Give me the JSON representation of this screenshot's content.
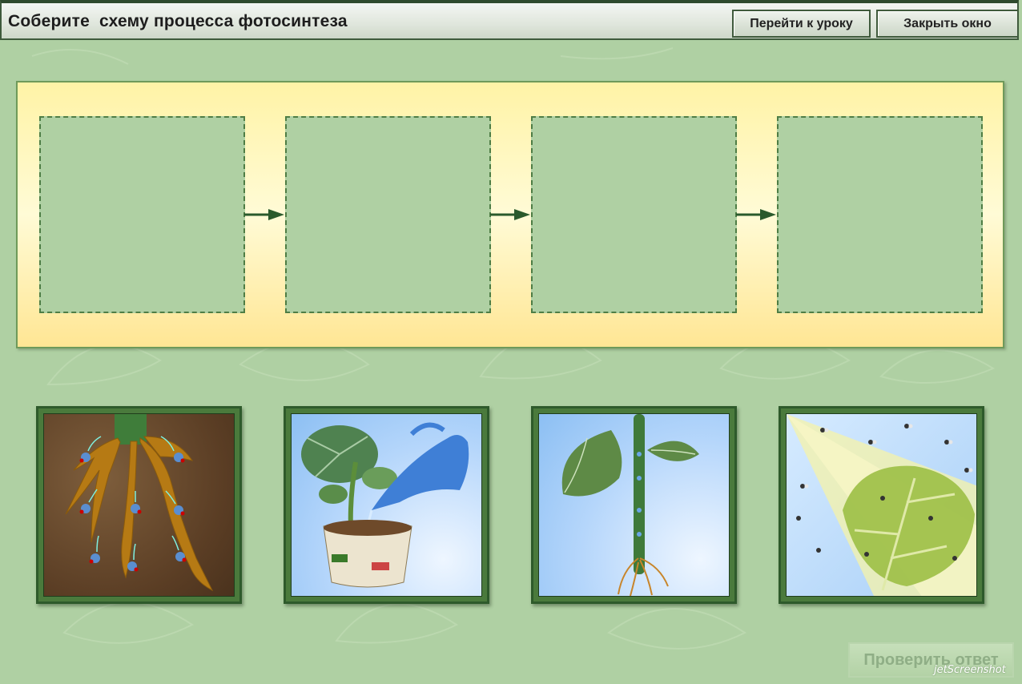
{
  "window": {
    "title": "Соберите  схему процесса фотосинтеза",
    "go_to_lesson_label": "Перейти к уроку",
    "close_window_label": "Закрыть окно"
  },
  "scheme": {
    "slots": [
      "",
      "",
      "",
      ""
    ],
    "arrow_icon": "arrow-right-icon"
  },
  "cards": [
    {
      "id": "roots-absorb-water",
      "icon": "roots-water-molecules-image"
    },
    {
      "id": "watering-plant",
      "icon": "watering-can-plant-image"
    },
    {
      "id": "water-rises-stem",
      "icon": "stem-water-transport-image"
    },
    {
      "id": "leaf-in-sunlight",
      "icon": "leaf-sunlight-co2-image"
    }
  ],
  "footer": {
    "check_answer_label": "Проверить ответ",
    "watermark": "jetScreenshot"
  },
  "colors": {
    "background": "#afd0a3",
    "panel": "#fff3a6",
    "card_frame": "#2e5a2b",
    "arrow": "#2a5a2c"
  }
}
